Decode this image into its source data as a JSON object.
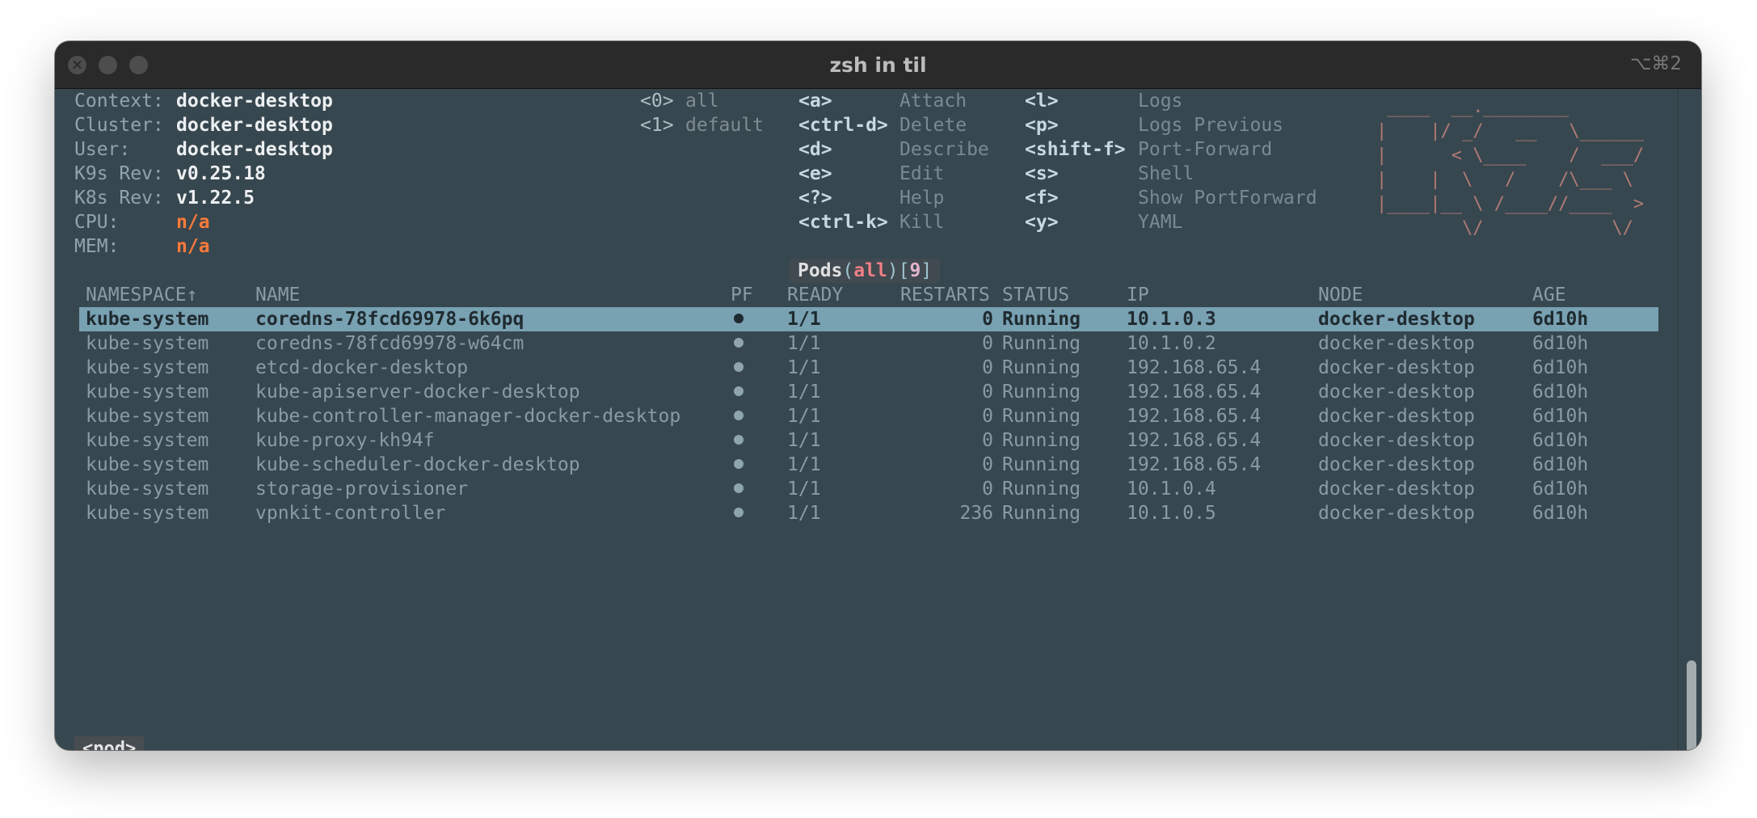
{
  "window": {
    "title": "zsh in til",
    "shortcut": "⌥⌘2"
  },
  "info": [
    {
      "label": "Context:",
      "value": "docker-desktop",
      "color": "white"
    },
    {
      "label": "Cluster:",
      "value": "docker-desktop",
      "color": "white"
    },
    {
      "label": "User:",
      "value": "docker-desktop",
      "color": "white"
    },
    {
      "label": "K9s Rev:",
      "value": "v0.25.18",
      "color": "white"
    },
    {
      "label": "K8s Rev:",
      "value": "v1.22.5",
      "color": "white"
    },
    {
      "label": "CPU:",
      "value": "n/a",
      "color": "#ff7a3a"
    },
    {
      "label": "MEM:",
      "value": "n/a",
      "color": "#ff7a3a"
    }
  ],
  "namespaces": [
    {
      "key": "<0>",
      "name": "all"
    },
    {
      "key": "<1>",
      "name": "default"
    }
  ],
  "hotkeys_col1": [
    {
      "key": "<a>",
      "action": "Attach"
    },
    {
      "key": "<ctrl-d>",
      "action": "Delete"
    },
    {
      "key": "<d>",
      "action": "Describe"
    },
    {
      "key": "<e>",
      "action": "Edit"
    },
    {
      "key": "<?>",
      "action": "Help"
    },
    {
      "key": "<ctrl-k>",
      "action": "Kill"
    }
  ],
  "hotkeys_col2": [
    {
      "key": "<l>",
      "action": "Logs"
    },
    {
      "key": "<p>",
      "action": "Logs Previous"
    },
    {
      "key": "<shift-f>",
      "action": "Port-Forward"
    },
    {
      "key": "<s>",
      "action": "Shell"
    },
    {
      "key": "<f>",
      "action": "Show PortForward"
    },
    {
      "key": "<y>",
      "action": "YAML"
    }
  ],
  "logo_lines": [
    " ____  __.________        ",
    "|    |/ _/   __   \\______ ",
    "|      < \\____    /  ___/ ",
    "|    |  \\   /    /\\___ \\  ",
    "|____|__ \\ /____//____  > ",
    "        \\/            \\/  "
  ],
  "resource_title": {
    "resource": "Pods",
    "namespace": "all",
    "count": "9"
  },
  "columns": [
    "NAMESPACE↑",
    "NAME",
    "PF",
    "READY",
    "RESTARTS",
    "STATUS",
    "IP",
    "NODE",
    "AGE"
  ],
  "pods": [
    {
      "namespace": "kube-system",
      "name": "coredns-78fcd69978-6k6pq",
      "pf": "●",
      "ready": "1/1",
      "restarts": "0",
      "status": "Running",
      "ip": "10.1.0.3",
      "node": "docker-desktop",
      "age": "6d10h",
      "selected": true
    },
    {
      "namespace": "kube-system",
      "name": "coredns-78fcd69978-w64cm",
      "pf": "●",
      "ready": "1/1",
      "restarts": "0",
      "status": "Running",
      "ip": "10.1.0.2",
      "node": "docker-desktop",
      "age": "6d10h"
    },
    {
      "namespace": "kube-system",
      "name": "etcd-docker-desktop",
      "pf": "●",
      "ready": "1/1",
      "restarts": "0",
      "status": "Running",
      "ip": "192.168.65.4",
      "node": "docker-desktop",
      "age": "6d10h"
    },
    {
      "namespace": "kube-system",
      "name": "kube-apiserver-docker-desktop",
      "pf": "●",
      "ready": "1/1",
      "restarts": "0",
      "status": "Running",
      "ip": "192.168.65.4",
      "node": "docker-desktop",
      "age": "6d10h"
    },
    {
      "namespace": "kube-system",
      "name": "kube-controller-manager-docker-desktop",
      "pf": "●",
      "ready": "1/1",
      "restarts": "0",
      "status": "Running",
      "ip": "192.168.65.4",
      "node": "docker-desktop",
      "age": "6d10h"
    },
    {
      "namespace": "kube-system",
      "name": "kube-proxy-kh94f",
      "pf": "●",
      "ready": "1/1",
      "restarts": "0",
      "status": "Running",
      "ip": "192.168.65.4",
      "node": "docker-desktop",
      "age": "6d10h"
    },
    {
      "namespace": "kube-system",
      "name": "kube-scheduler-docker-desktop",
      "pf": "●",
      "ready": "1/1",
      "restarts": "0",
      "status": "Running",
      "ip": "192.168.65.4",
      "node": "docker-desktop",
      "age": "6d10h"
    },
    {
      "namespace": "kube-system",
      "name": "storage-provisioner",
      "pf": "●",
      "ready": "1/1",
      "restarts": "0",
      "status": "Running",
      "ip": "10.1.0.4",
      "node": "docker-desktop",
      "age": "6d10h"
    },
    {
      "namespace": "kube-system",
      "name": "vpnkit-controller",
      "pf": "●",
      "ready": "1/1",
      "restarts": "236",
      "status": "Running",
      "ip": "10.1.0.5",
      "node": "docker-desktop",
      "age": "6d10h"
    }
  ],
  "breadcrumb": "<pod>",
  "colors": {
    "background": "#37474f",
    "selection": "#78a1b2",
    "accent_orange": "#ff7a3a",
    "logo": "#b07b75"
  }
}
